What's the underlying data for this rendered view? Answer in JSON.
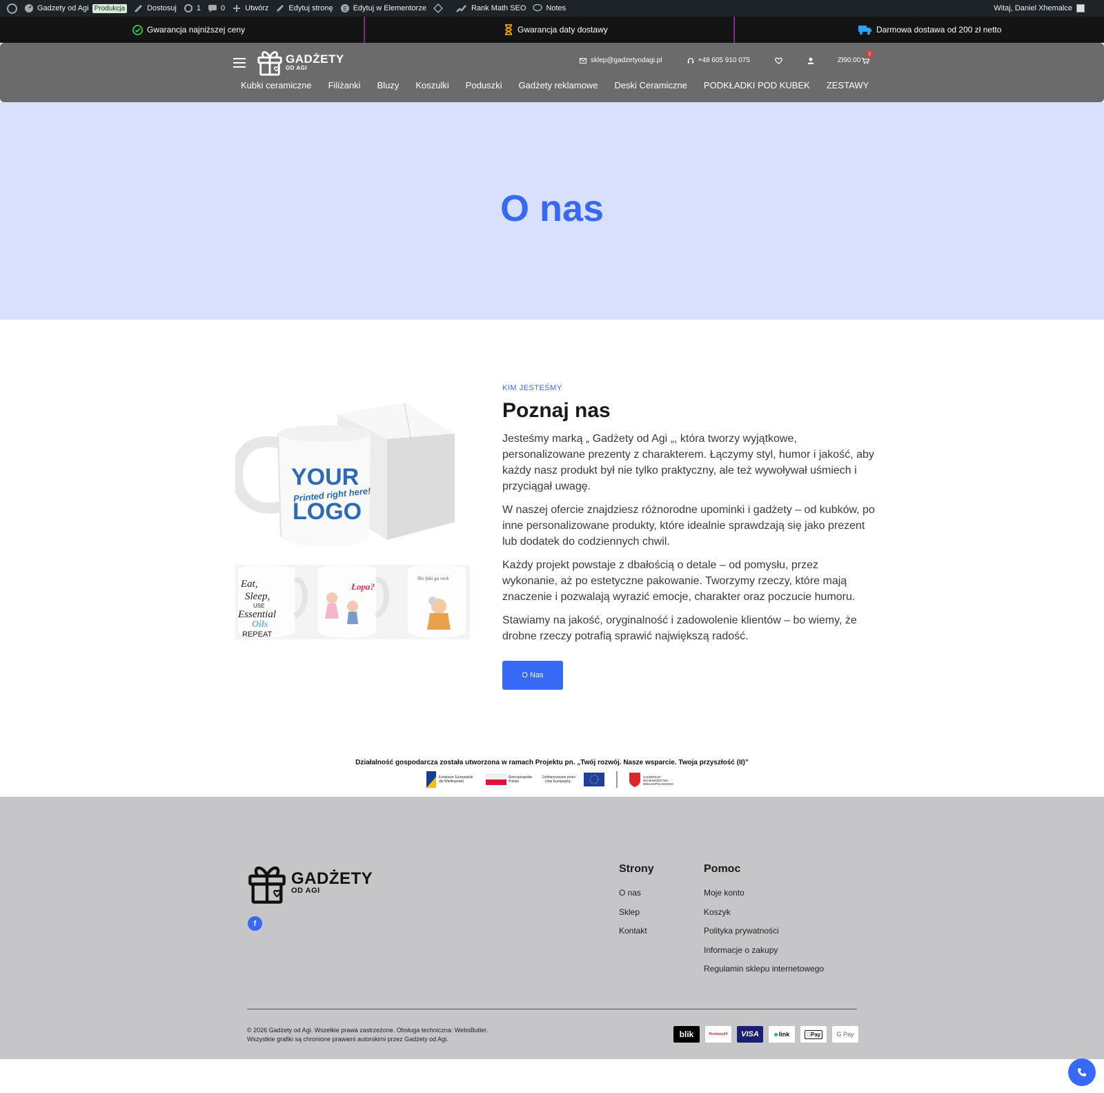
{
  "adminbar": {
    "site_name": "Gadzety od Agi",
    "env_badge": "Produkcja",
    "customize": "Dostosuj",
    "updates_count": "1",
    "comments_count": "0",
    "new": "Utwórz",
    "edit_page": "Edytuj stronę",
    "edit_elementor": "Edytuj w Elementorze",
    "rank_math": "Rank Math SEO",
    "notes": "Notes",
    "greeting": "Witaj, Daniel Xhemalce"
  },
  "promo": {
    "item1": "Gwarancja najniższej ceny",
    "item2": "Gwarancja daty dostawy",
    "item3": "Darmowa dostawa od 200 zł netto"
  },
  "header": {
    "logo_main": "GADŻETY",
    "logo_sub": "OD AGI",
    "email": "sklep@gadzetyodagi.pl",
    "phone": "+48 605 910 075",
    "cart_total": "Zł90.00",
    "cart_count": "2",
    "nav": [
      "Kubki ceramiczne",
      "Filiżanki",
      "Bluzy",
      "Koszulki",
      "Poduszki",
      "Gadżety reklamowe",
      "Deski Ceramiczne",
      "PODKŁADKI POD KUBEK",
      "ZESTAWY"
    ]
  },
  "hero": {
    "title": "O nas"
  },
  "about": {
    "eyebrow": "KIM JESTEŚMY",
    "heading": "Poznaj nas",
    "paragraphs": [
      "Jesteśmy marką „ Gadżety od Agi „, która tworzy wyjątkowe, personalizowane prezenty z charakterem. Łączymy styl, humor i jakość, aby każdy nasz produkt był nie tylko praktyczny, ale też wywoływał uśmiech i przyciągał uwagę.",
      "W naszej ofercie znajdziesz różnorodne upominki i gadżety – od kubków, po inne personalizowane produkty, które idealnie sprawdzają się jako prezent lub dodatek do codziennych chwil.",
      "Każdy projekt powstaje z dbałością o detale – od pomysłu, przez wykonanie, aż po estetyczne pakowanie. Tworzymy rzeczy, które mają znaczenie i pozwalają wyrazić emocje, charakter oraz poczucie humoru.",
      "Stawiamy na jakość, oryginalność i zadowolenie klientów – bo wiemy, że drobne rzeczy potrafią sprawić największą radość."
    ],
    "button": "O Nas",
    "mug_text_1": "YOUR",
    "mug_text_2": "Printed right here!",
    "mug_text_3": "LOGO"
  },
  "eu": {
    "line": "Działalność gospodarcza została utworzona w ramach Projektu pn. „Twój rozwój. Nasze wsparcie. Twoja przyszłość (II)”"
  },
  "footer": {
    "logo_main": "GADŻETY",
    "logo_sub": "OD AGI",
    "col1_title": "Strony",
    "col1_links": [
      "O nas",
      "Sklep",
      "Kontakt"
    ],
    "col2_title": "Pomoc",
    "col2_links": [
      "Moje konto",
      "Koszyk",
      "Polityka prywatności",
      "Informacje o zakupy",
      "Regulamin sklepu internetowego"
    ],
    "copyright_1": "© 2026 Gadżety od Agi. Wszelkie prawa zastrzeżone. Obsługa techniczna: WebsButler.",
    "copyright_2": "Wszystkie grafiki są chronione prawami autorskimi przez Gadżety od Agi.",
    "payments": [
      "blik",
      "Przelewy24",
      "VISA",
      "link",
      "Pay",
      "G Pay"
    ]
  },
  "colors": {
    "accent": "#3669f5",
    "hero_bg": "#d8e0fd",
    "header_bg": "#6b6b6b",
    "footer_bg": "#c6c6c8"
  }
}
